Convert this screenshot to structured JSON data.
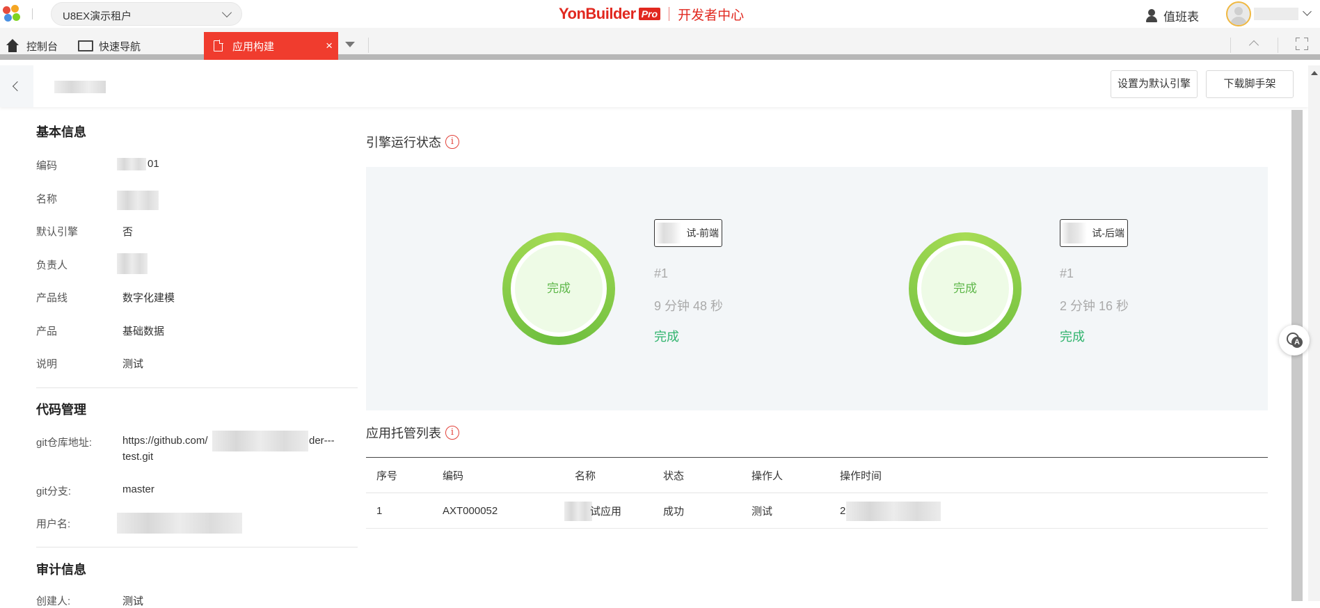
{
  "topbar": {
    "tenant": "U8EX演示租户",
    "brand_name": "YonBuilder",
    "brand_badge": "Pro",
    "brand_sub": "开发者中心",
    "duty": "值班表",
    "colors": {
      "brand": "#e1281f",
      "logo": [
        "#e74c3c",
        "#f5a623",
        "#4a90e2",
        "#7ed321"
      ]
    }
  },
  "tabs": {
    "console": "控制台",
    "quicknav": "快速导航",
    "active": "应用构建",
    "close": "×",
    "active_color": "#f03c2e"
  },
  "header": {
    "set_default": "设置为默认引擎",
    "download": "下载脚手架"
  },
  "basic": {
    "title": "基本信息",
    "fields": [
      {
        "label": "编码",
        "value": "01"
      },
      {
        "label": "名称",
        "value": ""
      },
      {
        "label": "默认引擎",
        "value": "否"
      },
      {
        "label": "负责人",
        "value": ""
      },
      {
        "label": "产品线",
        "value": "数字化建模"
      },
      {
        "label": "产品",
        "value": "基础数据"
      },
      {
        "label": "说明",
        "value": "测试"
      }
    ]
  },
  "code": {
    "title": "代码管理",
    "repo_label": "git仓库地址:",
    "repo_prefix": "https://github.com/",
    "repo_suffix": "der---",
    "repo_line2": "test.git",
    "branch_label": "git分支:",
    "branch": "master",
    "user_label": "用户名:"
  },
  "audit": {
    "title": "审计信息",
    "creator_label": "创建人:",
    "creator": "测试"
  },
  "engine": {
    "title": "引擎运行状态",
    "info": "i",
    "cards": [
      {
        "ring_text": "完成",
        "tag": "试-前端",
        "build": "#1",
        "duration": "9 分钟 48 秒",
        "status": "完成"
      },
      {
        "ring_text": "完成",
        "tag": "试-后端",
        "build": "#1",
        "duration": "2 分钟 16 秒",
        "status": "完成"
      }
    ],
    "colors": {
      "ring": "#6bbd3d",
      "ok": "#31b46e"
    }
  },
  "hosting": {
    "title": "应用托管列表",
    "info": "i",
    "columns": [
      "序号",
      "编码",
      "名称",
      "状态",
      "操作人",
      "操作时间"
    ],
    "rows": [
      [
        "1",
        "AXT000052",
        "试应用",
        "成功",
        "测试",
        "2"
      ]
    ]
  }
}
